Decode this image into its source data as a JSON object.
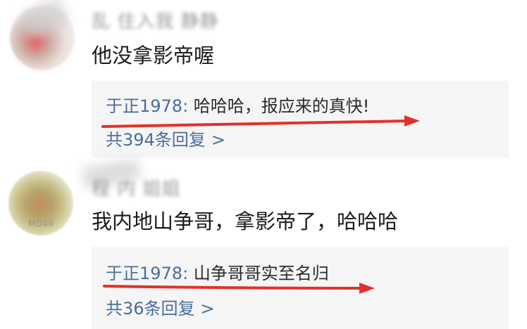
{
  "comments": [
    {
      "username": "乱    住入我   静静",
      "text": "他没拿影帝喔",
      "reply": {
        "author": "于正1978",
        "separator": ": ",
        "text": "哈哈哈，报应来的真快!"
      },
      "reply_count_label": "共394条回复",
      "chevron": ">"
    },
    {
      "username": "程     内    姐姐",
      "avatar_tag": "MD46",
      "text": "我内地山争哥，拿影帝了，哈哈哈",
      "reply": {
        "author": "于正1978",
        "separator": ": ",
        "text": "山争哥哥实至名归"
      },
      "reply_count_label": "共36条回复",
      "chevron": ">"
    }
  ],
  "annotation_color": "#e0322b"
}
